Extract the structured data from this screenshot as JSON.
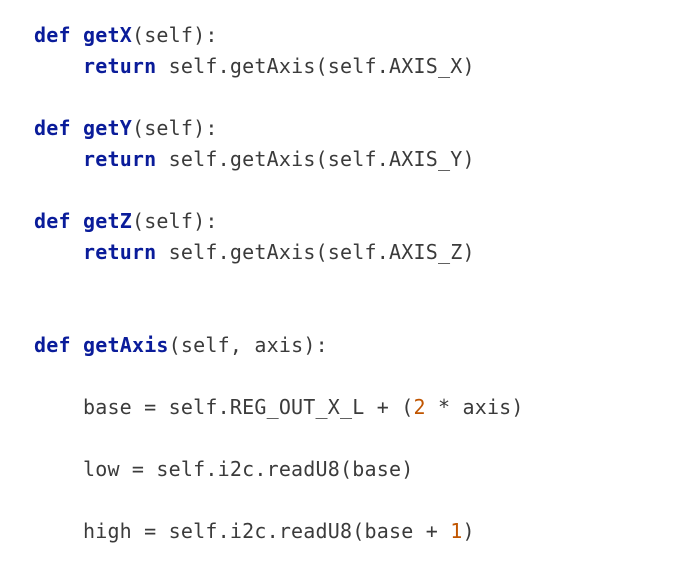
{
  "code": {
    "kw_def": "def",
    "kw_return": "return",
    "getX": {
      "name": "getX",
      "params": "(self):",
      "body_prefix": " self.getAxis(self.AXIS_X)"
    },
    "getY": {
      "name": "getY",
      "params": "(self):",
      "body_prefix": " self.getAxis(self.AXIS_Y)"
    },
    "getZ": {
      "name": "getZ",
      "params": "(self):",
      "body_prefix": " self.getAxis(self.AXIS_Z)"
    },
    "getAxis": {
      "name": "getAxis",
      "params": "(self, axis):",
      "line_base_a": "    base = self.REG_OUT_X_L + (",
      "num_two": "2",
      "line_base_b": " * axis)",
      "line_low": "    low = self.i2c.readU8(base)",
      "line_high_a": "    high = self.i2c.readU8(base + ",
      "num_one": "1",
      "line_high_b": ")"
    }
  }
}
